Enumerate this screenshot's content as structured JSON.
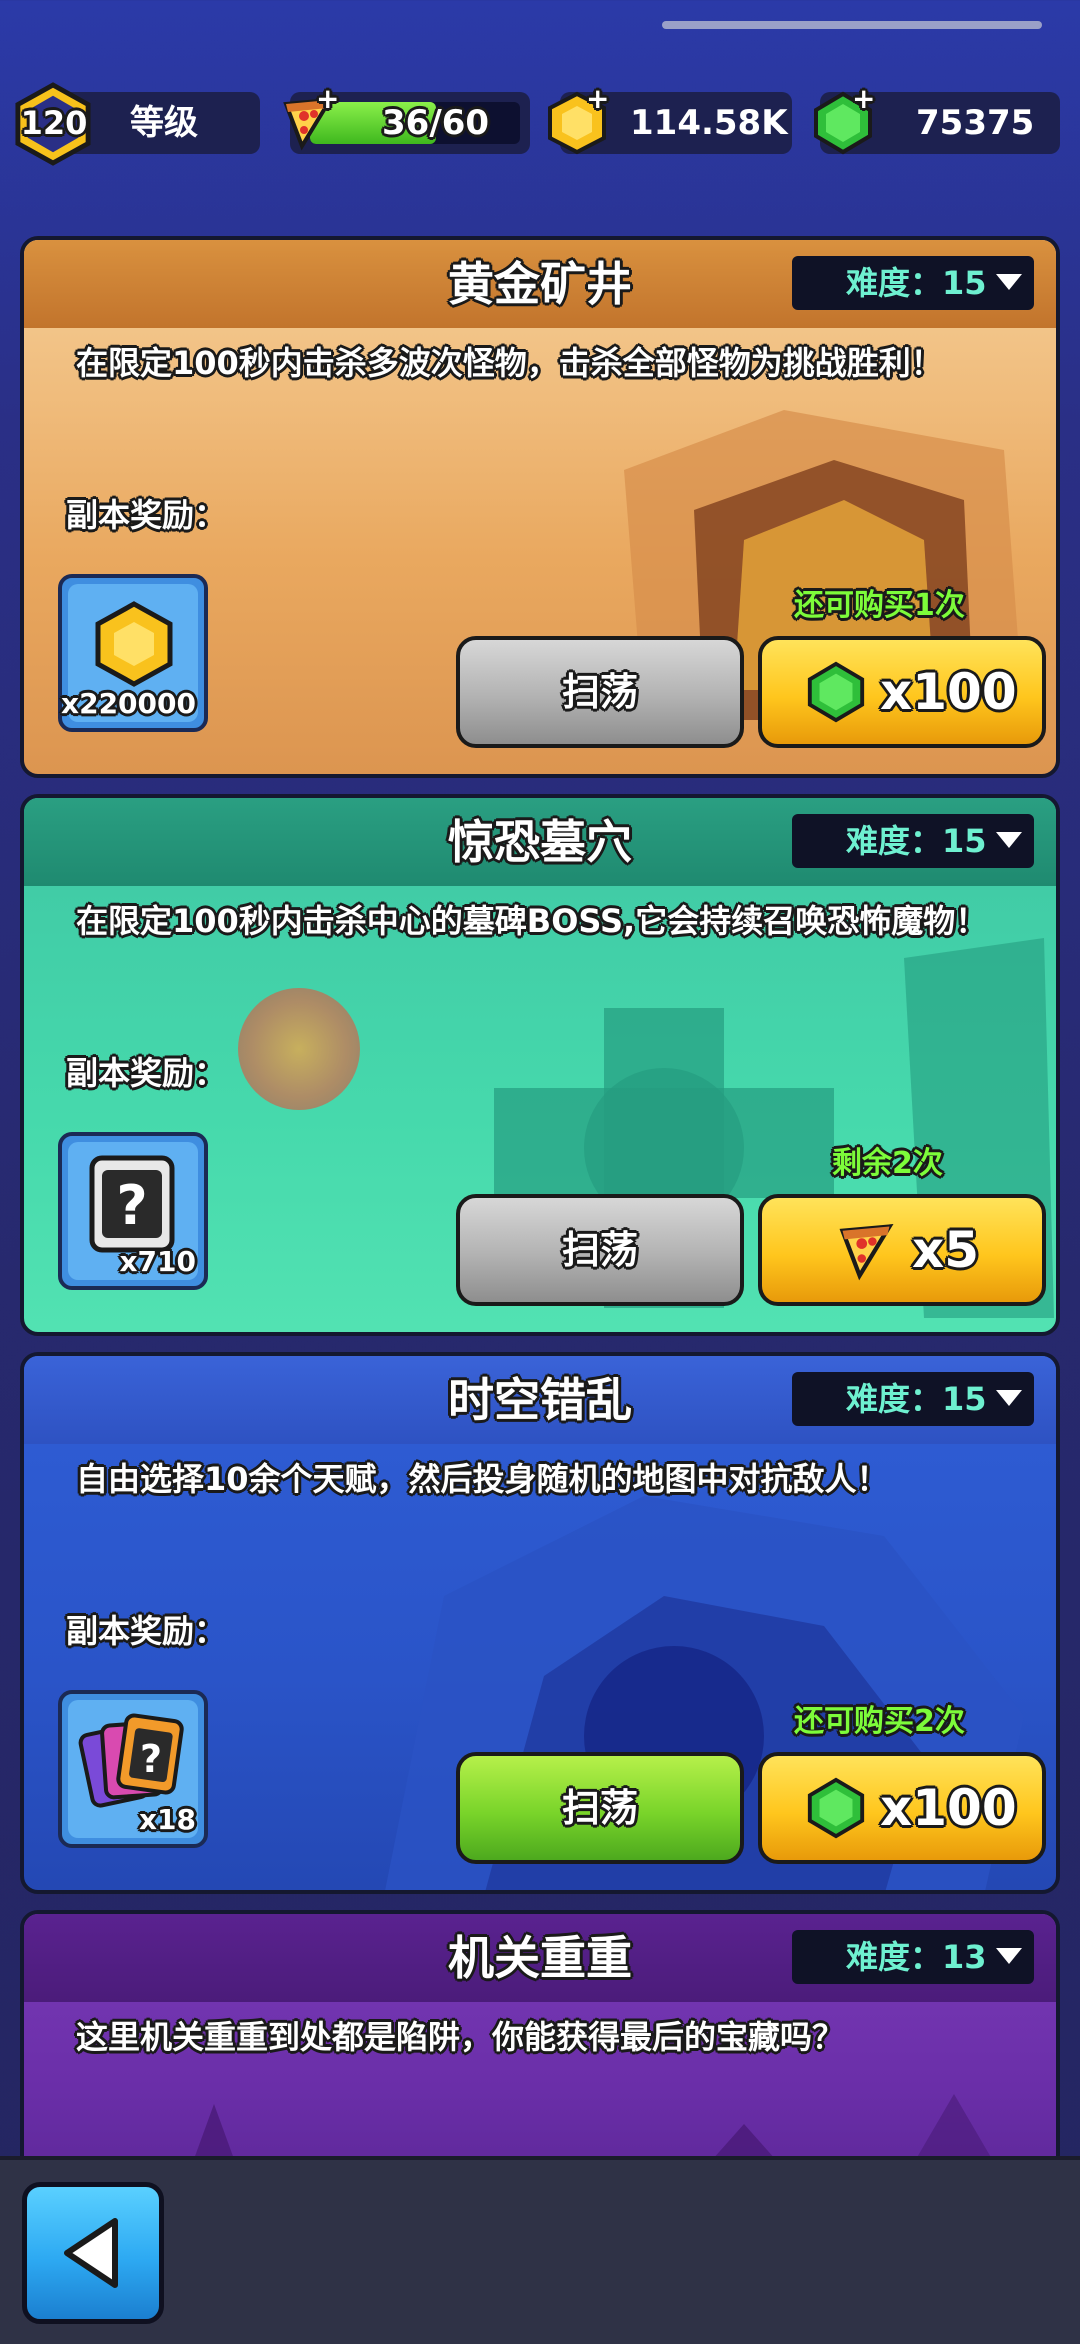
{
  "topbar": {
    "level": "120",
    "level_label": "等级",
    "energy": "36/60",
    "energy_fill": 0.6,
    "gold": "114.58K",
    "gems": "75375"
  },
  "dungeons": [
    {
      "title": "黄金矿井",
      "difficulty": "难度：15",
      "description": "在限定100秒内击杀多波次怪物，击杀全部怪物为挑战胜利！",
      "reward_label": "副本奖励：",
      "reward_qty": "x220000",
      "reward_icon": "gold-hex-coin-icon",
      "note": "还可购买1次",
      "sweep_label": "扫荡",
      "cost": "x100",
      "cost_icon": "gem-icon",
      "theme": "#d58a3b"
    },
    {
      "title": "惊恐墓穴",
      "difficulty": "难度：15",
      "description": "在限定100秒内击杀中心的墓碑BOSS,它会持续召唤恐怖魔物！",
      "reward_label": "副本奖励：",
      "reward_qty": "x710",
      "reward_icon": "mystery-card-icon",
      "note": "剩余2次",
      "sweep_label": "扫荡",
      "cost": "x5",
      "cost_icon": "pizza-icon",
      "theme": "#2fbf97"
    },
    {
      "title": "时空错乱",
      "difficulty": "难度：15",
      "description": "自由选择10余个天赋，然后投身随机的地图中对抗敌人！",
      "reward_label": "副本奖励：",
      "reward_qty": "x18",
      "reward_icon": "talent-cards-icon",
      "note": "还可购买2次",
      "sweep_label": "扫荡",
      "cost": "x100",
      "cost_icon": "gem-icon",
      "theme": "#2f5fd0"
    },
    {
      "title": "机关重重",
      "difficulty": "难度：13",
      "description": "这里机关重重到处都是陷阱，你能获得最后的宝藏吗？",
      "theme": "#6a2a9e"
    }
  ]
}
